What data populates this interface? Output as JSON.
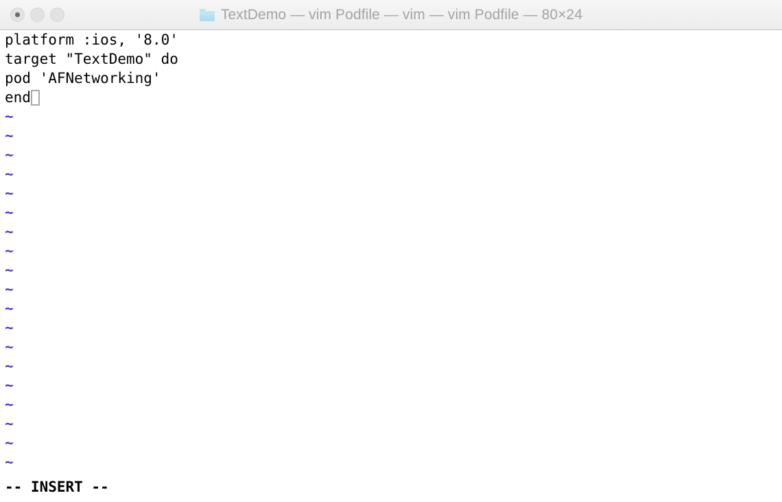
{
  "window": {
    "title": "TextDemo — vim Podfile — vim — vim Podfile — 80×24",
    "folder_icon": "folder-icon",
    "traffic_lights": [
      {
        "name": "close-button",
        "label": "Close"
      },
      {
        "name": "minimize-button",
        "label": "Minimize"
      },
      {
        "name": "zoom-button",
        "label": "Zoom"
      }
    ],
    "colors": {
      "titlebar_bg": "#f1f1f1",
      "titlebar_border": "#bfbfbf",
      "title_text": "#a3a3a3",
      "folder": "#b5e0f0",
      "terminal_bg": "#ffffff",
      "terminal_text": "#000000",
      "tilde": "#4a39cf",
      "cursor_outline": "#a8a8a8"
    }
  },
  "terminal": {
    "app": "vim",
    "file": "Podfile",
    "size": "80×24",
    "lines": [
      "platform :ios, '8.0'",
      "target \"TextDemo\" do",
      "pod 'AFNetworking'",
      "end"
    ],
    "cursor": {
      "line": 4,
      "column": 4,
      "style": "hollow-block"
    },
    "empty_marker": "~",
    "empty_line_count": 19,
    "status": "-- INSERT --"
  }
}
